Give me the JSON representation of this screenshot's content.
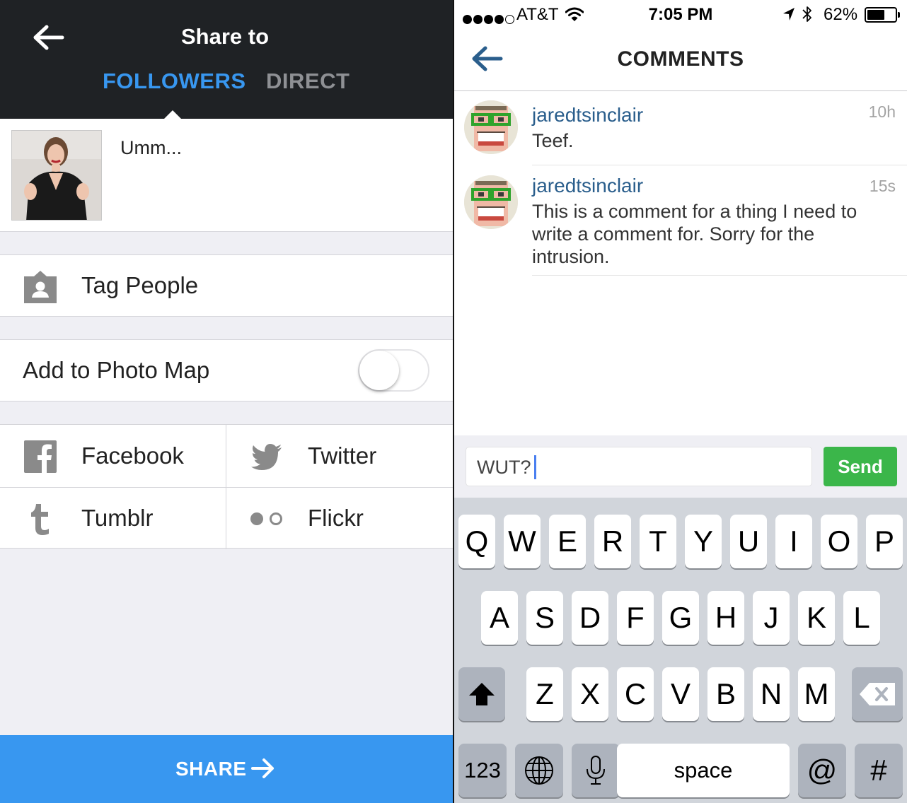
{
  "left": {
    "header": {
      "title": "Share to",
      "tabs": [
        {
          "label": "FOLLOWERS",
          "active": true
        },
        {
          "label": "DIRECT",
          "active": false
        }
      ]
    },
    "post": {
      "caption": "Umm..."
    },
    "tag_people": {
      "label": "Tag People",
      "icon": "tag-person-icon"
    },
    "photo_map": {
      "label": "Add to Photo Map",
      "enabled": false
    },
    "services": [
      {
        "label": "Facebook",
        "icon": "facebook-icon"
      },
      {
        "label": "Twitter",
        "icon": "twitter-icon"
      },
      {
        "label": "Tumblr",
        "icon": "tumblr-icon"
      },
      {
        "label": "Flickr",
        "icon": "flickr-icon"
      }
    ],
    "share_button": {
      "label": "SHARE"
    }
  },
  "right": {
    "status_bar": {
      "carrier": "AT&T",
      "time": "7:05 PM",
      "battery": "62%",
      "battery_level": 0.62
    },
    "nav": {
      "title": "COMMENTS"
    },
    "comments": [
      {
        "user": "jaredtsinclair",
        "time": "10h",
        "text": "Teef."
      },
      {
        "user": "jaredtsinclair",
        "time": "15s",
        "text": "This is a comment for a thing I need to write a comment for. Sorry for the intrusion."
      }
    ],
    "compose": {
      "value": "WUT?",
      "send_label": "Send"
    },
    "keyboard": {
      "row1": [
        "Q",
        "W",
        "E",
        "R",
        "T",
        "Y",
        "U",
        "I",
        "O",
        "P"
      ],
      "row2": [
        "A",
        "S",
        "D",
        "F",
        "G",
        "H",
        "J",
        "K",
        "L"
      ],
      "row3": [
        "Z",
        "X",
        "C",
        "V",
        "B",
        "N",
        "M"
      ],
      "numbers_label": "123",
      "space_label": "space",
      "at_label": "@",
      "hash_label": "#"
    }
  },
  "colors": {
    "accent_blue": "#3897f0",
    "header_dark": "#1f2225",
    "username_blue": "#2a5e8c",
    "send_green": "#3bb64a"
  }
}
